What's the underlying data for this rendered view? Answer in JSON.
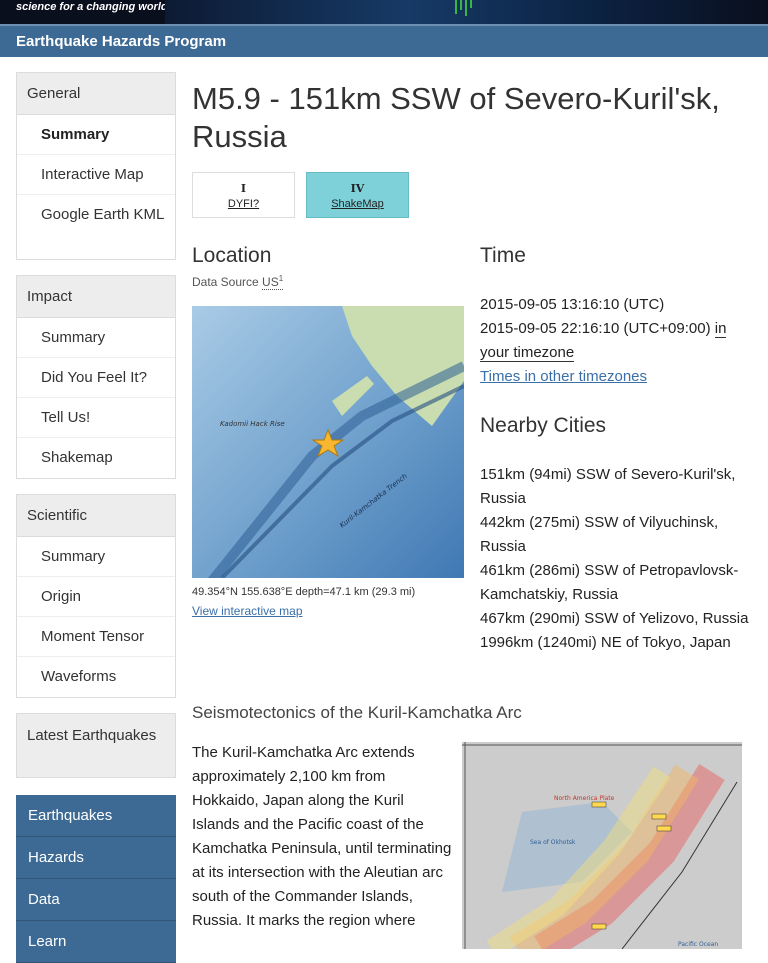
{
  "header": {
    "tagline": "science for a changing world",
    "program": "Earthquake Hazards Program"
  },
  "sidebar": {
    "general": {
      "title": "General",
      "items": [
        "Summary",
        "Interactive Map",
        "Google Earth KML"
      ]
    },
    "impact": {
      "title": "Impact",
      "items": [
        "Summary",
        "Did You Feel It?",
        "Tell Us!",
        "Shakemap"
      ]
    },
    "scientific": {
      "title": "Scientific",
      "items": [
        "Summary",
        "Origin",
        "Moment Tensor",
        "Waveforms"
      ]
    },
    "latest": "Latest Earthquakes",
    "nav": [
      "Earthquakes",
      "Hazards",
      "Data",
      "Learn"
    ]
  },
  "event": {
    "title": "M5.9 - 151km SSW of Severo-Kuril'sk, Russia",
    "dyfi": {
      "level": "I",
      "label": "DYFI?"
    },
    "shakemap": {
      "level": "IV",
      "label": "ShakeMap"
    }
  },
  "location": {
    "heading": "Location",
    "source_prefix": "Data Source",
    "source": "US",
    "source_sup": "1",
    "coords": "49.354°N 155.638°E depth=47.1 km (29.3 mi)",
    "view_map": "View interactive map",
    "map_labels": {
      "rise": "Kadomii Hack Rise",
      "trench": "Kuril-Kamchatka Trench"
    }
  },
  "time": {
    "heading": "Time",
    "utc": "2015-09-05 13:16:10 (UTC)",
    "local": "2015-09-05 22:16:10 (UTC+09:00)",
    "local_suffix": "in your timezone",
    "other": "Times in other timezones"
  },
  "nearby": {
    "heading": "Nearby Cities",
    "cities": [
      "151km (94mi) SSW of Severo-Kuril'sk, Russia",
      "442km (275mi) SSW of Vilyuchinsk, Russia",
      "461km (286mi) SSW of Petropavlovsk-Kamchatskiy, Russia",
      "467km (290mi) SSW of Yelizovo, Russia",
      "1996km (1240mi) NE of Tokyo, Japan"
    ]
  },
  "seismotectonics": {
    "title": "Seismotectonics of the Kuril-Kamchatka Arc",
    "text": "The Kuril-Kamchatka Arc extends approximately 2,100 km from Hokkaido, Japan along the Kuril Islands and the Pacific coast of the Kamchatka Peninsula, until terminating at its intersection with the Aleutian arc south of the Commander Islands, Russia. It marks the region where",
    "map_labels": {
      "plate": "North America Plate",
      "sea": "Sea of Okhotsk",
      "pacific": "Pacific Ocean"
    }
  },
  "colors": {
    "accent": "#3d6a94",
    "shakemap": "#7fd1d9",
    "link": "#3a6fa8"
  }
}
